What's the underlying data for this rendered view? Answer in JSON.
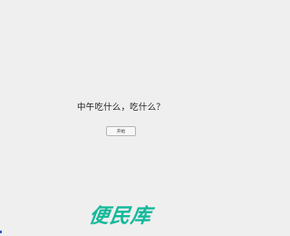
{
  "question": {
    "text": "中午吃什么，吃什么？"
  },
  "start_button": {
    "label": "开始"
  },
  "watermark": {
    "text": "便民库"
  },
  "colors": {
    "background": "#efefef",
    "watermark": "#14b89a",
    "corner_mark": "#3952c9"
  }
}
